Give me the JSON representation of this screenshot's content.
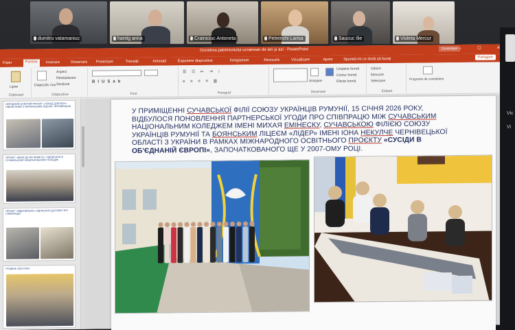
{
  "zoom": {
    "participants": [
      {
        "name": "dumitru vatamaniuc"
      },
      {
        "name": "hantig anna"
      },
      {
        "name": "Crainiciuc Antoneta"
      },
      {
        "name": "Petrenchi Larisa"
      },
      {
        "name": "Saucuc Ilie"
      },
      {
        "name": "Violeta Mercur"
      }
    ],
    "side_labels": [
      "Vic",
      "Vi"
    ]
  },
  "powerpoint": {
    "doc_title": "Ocrotirea patrimoniului ucrainean de ieri și azi · PowerPoint",
    "signin_label": "Conectare",
    "share_label": "Partajare",
    "menu": [
      "Fișier",
      "Pornire",
      "Inserare",
      "Desenare",
      "Proiectare",
      "Tranziții",
      "Animații",
      "Expunere diapozitive",
      "Înregistrare",
      "Revizuire",
      "Vizualizare",
      "Ajutor",
      "Spuneți-mi ce doriți să faceți"
    ],
    "active_menu_index": 1,
    "ribbon": {
      "clipboard": {
        "paste": "Lipire",
        "label": "Clipboard"
      },
      "slides": {
        "new": "Diapozitiv nou",
        "layout": "Aspect",
        "reset": "Reinițializare",
        "section": "Secțiune",
        "label": "Diapozitive"
      },
      "font": {
        "label": "Font"
      },
      "paragraph": {
        "label": "Paragraf"
      },
      "drawing": {
        "arrange": "Aranjare",
        "styles": "Stiluri rapide",
        "fill": "Umplere formă",
        "outline": "Contur formă",
        "effects": "Efecte formă",
        "label": "Desenare"
      },
      "editing": {
        "find": "Găsire",
        "replace": "Înlocuire",
        "select": "Selectare",
        "label": "Editare"
      },
      "addins": {
        "name": "Programe de completare",
        "label": "Programe de completare"
      }
    },
    "slide": {
      "line1_a": "У приміщенні ",
      "line1_u": "Сучавської",
      "line1_b": " філії Союзу українців Румунії, 15 січня 2026 року,",
      "line2": "відбулося поновлення партнерської угоди про співпрацю між ",
      "line2_u": "Сучавським",
      "line3": "національним коледжем імені Михая ",
      "line3_u1": "Емінеску",
      "line3_m": ", ",
      "line3_u2": "Сучавською",
      "line3_e": " філією Союзу",
      "line4": "українців Румунії та ",
      "line4_u": "Боянським",
      "line4_m": " ліцеєм «лідер» імені Іона ",
      "line4_u2": "Некулче",
      "line4_e": " Чернівецької",
      "line5": "області з України в рамках міжнародного освітнього ",
      "line5_u": "проєкту",
      "line5_b": " «Сусіди в",
      "line6_b": "об'єднаній Європі»",
      "line6_e": ", започаткованого ще у 2007-ому році."
    },
    "thumbnails": [
      {
        "text": "НАРОДНИЙ ОСВІТНІЙ ПРОЄКТ «СОНЦЕ ДЛЯ ВСІХ» ПІДПИСАНИЙ З УКРАЇНСЬКИМ ЛІЦЕЄМ, ЧЕРНІВЕЦЬКА"
      },
      {
        "text": "ПРОЄКТ «ВАШЕ ДЕ ВИ ЖИВЕТЕ» ПІДПИСАНО В СУЧАВСЬКОМУ НАЦІОНАЛЬНОМУ КОЛЕДЖІ"
      },
      {
        "text": "ПРОЄКТ «ВІДНОВЛЕНО» ПІДПИСАНО ДОГОВІР ПРО СПІВПРАЦЮ"
      },
      {
        "text": "ГРУДЕНЬ 2025 РОКУ"
      }
    ]
  }
}
